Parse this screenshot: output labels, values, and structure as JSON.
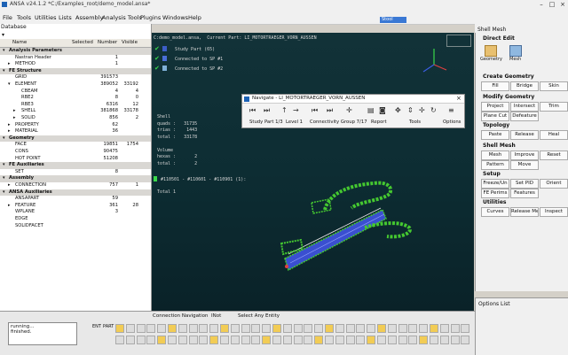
{
  "window": {
    "title": "ANSA v24.1.2 *C:/Examples_root/demo_model.ansa*",
    "min": "–",
    "max": "□",
    "close": "×"
  },
  "menubar": [
    "File",
    "Tools",
    "Utilities",
    "Lists",
    "Assembly",
    "Analysis Tools",
    "Plugins",
    "Windows",
    "Help"
  ],
  "search": {
    "value": "Stool"
  },
  "database": {
    "title": "Database",
    "columns": [
      "Name",
      "Selected",
      "Number",
      "Visible"
    ],
    "rows": [
      {
        "name": "Analysis Parameters",
        "sec": true,
        "arrow": "▾"
      },
      {
        "name": "Nastran Header",
        "sel": "",
        "num": "1",
        "vis": "",
        "indent": 1
      },
      {
        "name": "METHOD",
        "sel": "",
        "num": "1",
        "vis": "",
        "indent": 1,
        "arrow": "▸"
      },
      {
        "name": "FE Structure",
        "sec": true,
        "arrow": "▾"
      },
      {
        "name": "GRID",
        "sel": "",
        "num": "391573",
        "vis": "",
        "indent": 1
      },
      {
        "name": "ELEMENT",
        "sel": "",
        "num": "389052",
        "vis": "33192",
        "indent": 1,
        "arrow": "▾"
      },
      {
        "name": "CBEAM",
        "sel": "",
        "num": "4",
        "vis": "4",
        "indent": 2
      },
      {
        "name": "RBE2",
        "sel": "",
        "num": "8",
        "vis": "0",
        "indent": 2
      },
      {
        "name": "RBE3",
        "sel": "",
        "num": "6316",
        "vis": "12",
        "indent": 2
      },
      {
        "name": "SHELL",
        "sel": "",
        "num": "381868",
        "vis": "33178",
        "indent": 2,
        "arrow": "▸"
      },
      {
        "name": "SOLID",
        "sel": "",
        "num": "856",
        "vis": "2",
        "indent": 2,
        "arrow": "▸"
      },
      {
        "name": "PROPERTY",
        "sel": "",
        "num": "62",
        "vis": "",
        "indent": 1,
        "arrow": "▸"
      },
      {
        "name": "MATERIAL",
        "sel": "",
        "num": "36",
        "vis": "",
        "indent": 1,
        "arrow": "▸"
      },
      {
        "name": "Geometry",
        "sec": true,
        "arrow": "▾"
      },
      {
        "name": "FACE",
        "sel": "",
        "num": "19851",
        "vis": "1754",
        "indent": 1
      },
      {
        "name": "CONS",
        "sel": "",
        "num": "90475",
        "vis": "",
        "indent": 1
      },
      {
        "name": "HOT POINT",
        "sel": "",
        "num": "51208",
        "vis": "",
        "indent": 1
      },
      {
        "name": "FE Auxiliaries",
        "sec": true,
        "arrow": "▾"
      },
      {
        "name": "SET",
        "sel": "",
        "num": "8",
        "vis": "",
        "indent": 1
      },
      {
        "name": "Assembly",
        "sec": true,
        "arrow": "▾"
      },
      {
        "name": "CONNECTION",
        "sel": "",
        "num": "757",
        "vis": "1",
        "indent": 1,
        "arrow": "▸"
      },
      {
        "name": "ANSA Auxiliaries",
        "sec": true,
        "arrow": "▾"
      },
      {
        "name": "ANSAPART",
        "sel": "",
        "num": "59",
        "vis": "",
        "indent": 1
      },
      {
        "name": "FEATURE",
        "sel": "",
        "num": "361",
        "vis": "28",
        "indent": 1,
        "arrow": "▸"
      },
      {
        "name": "WPLANE",
        "sel": "",
        "num": "3",
        "vis": "",
        "indent": 1
      },
      {
        "name": "EDGE",
        "sel": "",
        "num": "",
        "vis": "",
        "indent": 1
      },
      {
        "name": "SOLIDFACET",
        "sel": "",
        "num": "",
        "vis": "",
        "indent": 1
      }
    ]
  },
  "viewport": {
    "header": "C:demo_model.ansa,  Current Part: LI_MOTORTRAEGER_VORN_AUSSEN",
    "status": [
      "Study Part (65)",
      "Connected to SP #1",
      "Connected to SP #2"
    ],
    "stats": "Shell\nquads :   31735\ntrias :    1443\ntotal :   33178\n\nVolume\nhexas :       2\ntotal :       2",
    "selection": "#110501 - #110601 - #110901 (1):",
    "total": "Total 1",
    "colors": {
      "check": "#39d84a",
      "accent_blue": "#3c5ec8",
      "mesh_green": "#45c830",
      "mesh_blue": "#3a4fd0"
    }
  },
  "navigate": {
    "title": "Navigate - LI_MOTORTRAEGER_VORN_AUSSEN",
    "labels": [
      "Study Part 1/3",
      "Level 1",
      "Connectivity Group 7/17",
      "Report",
      "Tools",
      "Options"
    ]
  },
  "right": {
    "title": "Shell Mesh",
    "direct_edit": "Direct Edit",
    "geometry": "Geometry",
    "mesh": "Mesh",
    "sections": [
      {
        "h": "Create Geometry",
        "btns": [
          "Fill",
          "Bridge",
          "Skin"
        ]
      },
      {
        "h": "Modify Geometry",
        "btns": [
          "Project",
          "Intersect",
          "Trim",
          "Plane Cut",
          "Defeature"
        ]
      },
      {
        "h": "Topology",
        "btns": [
          "Paste",
          "Release",
          "Heal"
        ]
      },
      {
        "h": "Shell Mesh",
        "btns": [
          "Mesh",
          "Improve",
          "Reset",
          "Pattern",
          "Move"
        ]
      },
      {
        "h": "Setup",
        "btns": [
          "Freeze/Un",
          "Set PID",
          "Orient",
          "FE Perims",
          "Features"
        ]
      },
      {
        "h": "Utilities",
        "btns": [
          "Curves",
          "Release Me.",
          "Inspect"
        ]
      }
    ],
    "options_list": "Options List"
  },
  "bottom": {
    "messages": "running...\nfinished.",
    "tabs": [
      "Connection Navigation",
      "INot",
      "Select Any Entity"
    ],
    "ent": "ENT",
    "part": "PART"
  }
}
